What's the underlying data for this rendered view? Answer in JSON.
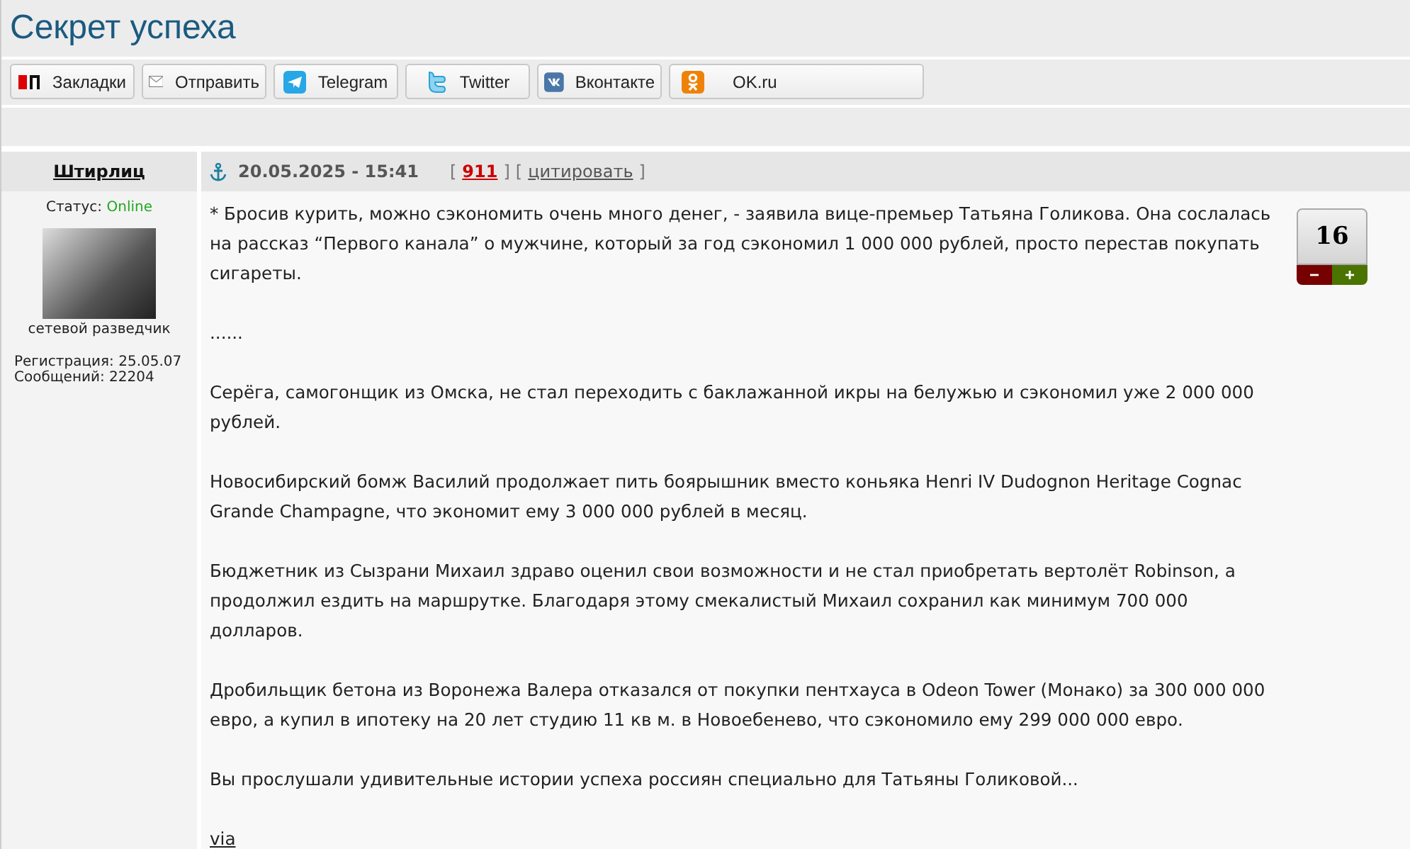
{
  "title": "Секрет успеха",
  "share_buttons": [
    {
      "kind": "yandex",
      "label": "Закладки"
    },
    {
      "kind": "mail",
      "label": "Отправить"
    },
    {
      "kind": "telegram",
      "label": "Telegram"
    },
    {
      "kind": "twitter",
      "label": "Twitter"
    },
    {
      "kind": "vk",
      "label": "Вконтакте"
    },
    {
      "kind": "ok",
      "label": "OK.ru"
    }
  ],
  "post": {
    "author": "Штирлиц",
    "date": "20.05.2025 - 15:41",
    "bracket_open": "[",
    "number": "911",
    "bracket_close": "]",
    "quote": "цитировать",
    "status_label": "Статус:",
    "status": "Online",
    "rank": "сетевой разведчик",
    "registration": "Регистрация: 25.05.07",
    "messages": "Сообщений: 22204",
    "rating": "16",
    "rating_minus": "−",
    "rating_plus": "+",
    "paragraphs": [
      "* Бросив курить, можно сэкономить очень много денег, - заявила вице-премьер Татьяна Голикова. Она сослалась на рассказ “Первого канала” о мужчине, который за год сэкономил 1 000 000 рублей, просто перестав покупать сигареты.",
      "......",
      "Серёга, самогонщик из Омска, не стал переходить с баклажанной икры на белужью и сэкономил уже 2 000 000 рублей.",
      "Новосибирский бомж Василий продолжает пить боярышник вместо коньяка Henri IV Dudognon Heritage Cognac Grande Champagne, что экономит ему 3 000 000 рублей в месяц.",
      "Бюджетник из Сызрани Михаил здраво оценил свои возможности и не стал приобретать вертолёт Robinson, а продолжил ездить на маршрутке. Благодаря этому смекалистый Михаил сохранил как минимум 700 000 долларов.",
      "Дробильщик бетона из Воронежа Валера отказался от покупки пентхауса в Odeon Tower (Монако) за 300 000 000 евро, а купил в ипотеку на 20 лет студию 11 кв м. в Новоебенево, что сэкономило ему 299 000 000 евро.",
      "Вы прослушали удивительные истории успеха россиян специально для Татьяны Голиковой..."
    ],
    "via": "via"
  }
}
